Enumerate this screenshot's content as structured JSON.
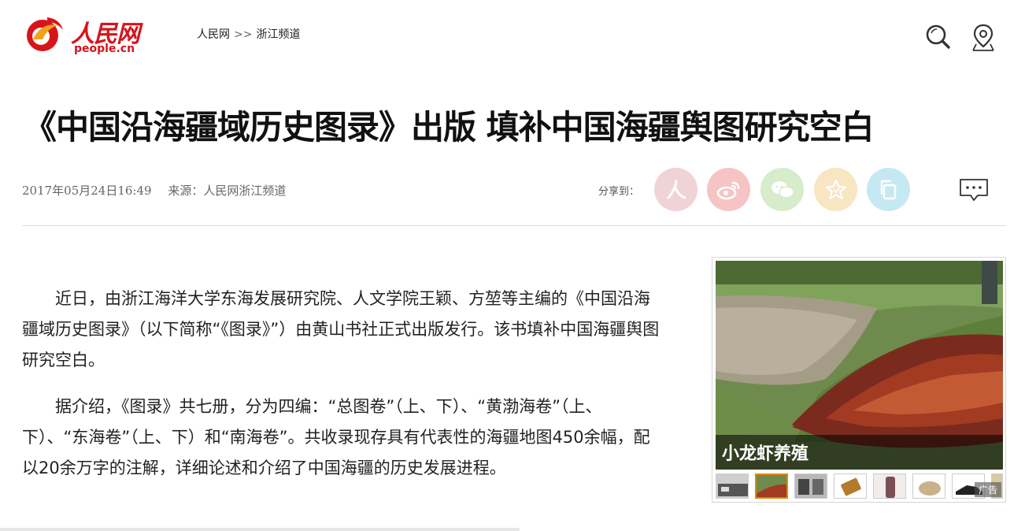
{
  "header": {
    "logo_text": "人民网",
    "logo_sub": "people.cn",
    "breadcrumb": {
      "home": "人民网",
      "separator": ">>",
      "channel": "浙江频道"
    },
    "icons": [
      "search-icon",
      "location-icon"
    ]
  },
  "article": {
    "title": "《中国沿海疆域历史图录》出版 填补中国海疆舆图研究空白",
    "date": "2017年05月24日16:49",
    "source_label": "来源：",
    "source_name": "人民网浙江频道",
    "paragraphs": [
      "近日，由浙江海洋大学东海发展研究院、人文学院王颖、方堃等主编的《中国沿海疆域历史图录》（以下简称“《图录》”）由黄山书社正式出版发行。该书填补中国海疆舆图研究空白。",
      "据介绍，《图录》共七册，分为四编：“总图卷”（上、下）、“黄渤海卷”（上、下）、“东海卷”（上、下）和“南海卷”。共收录现存具有代表性的海疆地图450余幅，配以20余万字的注解，详细论述和介绍了中国海疆的历史发展进程。"
    ]
  },
  "share": {
    "label": "分享到：",
    "buttons": [
      {
        "name": "people-share",
        "icon": "people-icon",
        "color": "#f0d3d6"
      },
      {
        "name": "weibo-share",
        "icon": "weibo-icon",
        "color": "#f7c4c6"
      },
      {
        "name": "wechat-share",
        "icon": "wechat-icon",
        "color": "#d6ecca"
      },
      {
        "name": "favorite-share",
        "icon": "star-icon",
        "color": "#f8e6c2"
      },
      {
        "name": "copy-share",
        "icon": "copy-icon",
        "color": "#c5e9f2"
      }
    ],
    "comment_icon": "comment-icon"
  },
  "ad": {
    "caption": "小龙虾养殖",
    "tag": "广告"
  },
  "colors": {
    "brand_red": "#d7141a",
    "text": "#222222",
    "meta": "#666666"
  }
}
